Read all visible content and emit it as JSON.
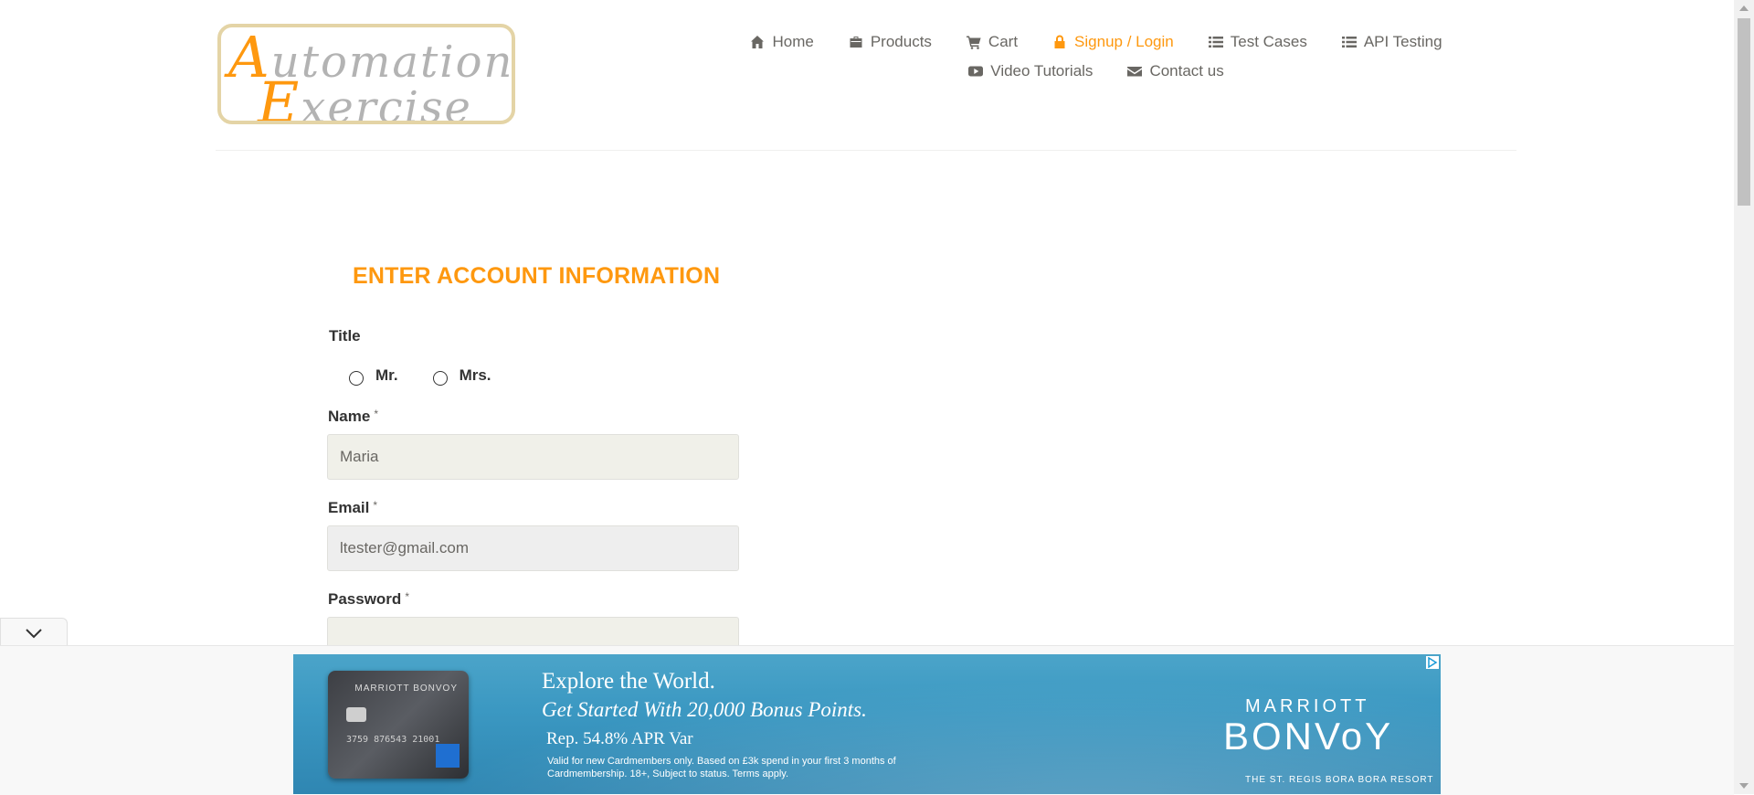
{
  "logo": {
    "line1_cap": "A",
    "line1_rest": "utomation",
    "line2_cap": "E",
    "line2_rest": "xercise"
  },
  "nav": {
    "items": [
      {
        "label": "Home",
        "icon": "home-icon"
      },
      {
        "label": "Products",
        "icon": "briefcase-icon"
      },
      {
        "label": "Cart",
        "icon": "shopping-cart-icon"
      },
      {
        "label": "Signup / Login",
        "icon": "lock-icon",
        "active": true
      },
      {
        "label": "Test Cases",
        "icon": "list-icon"
      },
      {
        "label": "API Testing",
        "icon": "list-icon"
      },
      {
        "label": "Video Tutorials",
        "icon": "youtube-play-icon"
      },
      {
        "label": "Contact us",
        "icon": "envelope-icon"
      }
    ]
  },
  "form": {
    "heading": "ENTER ACCOUNT INFORMATION",
    "title_label": "Title",
    "title_options": [
      "Mr.",
      "Mrs."
    ],
    "name_label": "Name",
    "name_value": "Maria",
    "email_label": "Email",
    "email_value": "ltester@gmail.com",
    "password_label": "Password",
    "password_value": "",
    "required_mark": "*"
  },
  "ad": {
    "card_brand": "MARRIOTT BONVOY",
    "card_number": "3759 876543 21001",
    "line1": "Explore the World.",
    "line2": "Get Started With 20,000 Bonus Points.",
    "line3": "Rep. 54.8% APR Var",
    "line4": "Valid for new Cardmembers only. Based on £3k spend in your first 3 months of Cardmembership. 18+, Subject to status. Terms apply.",
    "brand_top": "MARRIOTT",
    "brand_main": "BONVoY",
    "brand_bottom": "THE ST. REGIS BORA BORA RESORT"
  },
  "colors": {
    "accent": "#fe980f",
    "nav_text": "#696763",
    "input_bg": "#f0f0e9"
  }
}
